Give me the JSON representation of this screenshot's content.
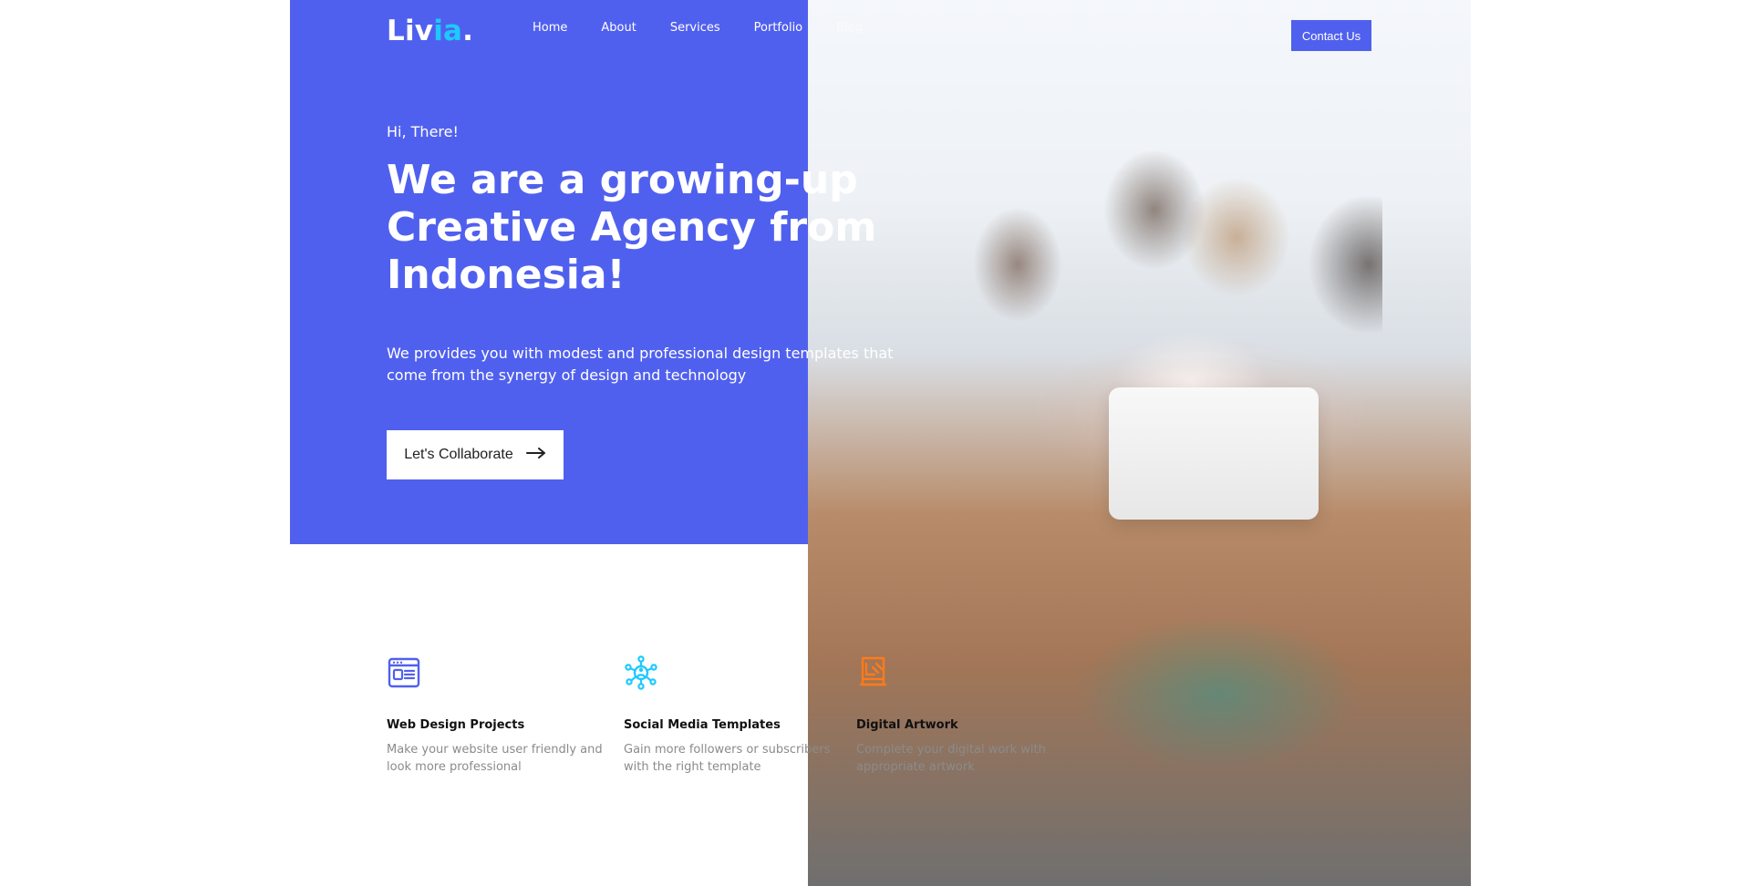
{
  "header": {
    "logo_prefix": "Liv",
    "logo_accent": "ia",
    "logo_suffix": ".",
    "nav": [
      "Home",
      "About",
      "Services",
      "Portfolio",
      "Blog"
    ],
    "contact_label": "Contact Us"
  },
  "hero": {
    "greeting": "Hi, There!",
    "headline": "We are a growing-up Creative Agency from Indonesia!",
    "lead": "We provides you with modest and professional design templates that come from the synergy of design and technology",
    "cta_label": "Let's Collaborate"
  },
  "services": [
    {
      "icon": "web-browser-icon",
      "title": "Web Design Projects",
      "description": "Make your website user friendly and look more professional"
    },
    {
      "icon": "network-share-icon",
      "title": "Social Media Templates",
      "description": "Gain more followers or subscribers with the right template"
    },
    {
      "icon": "artwork-board-icon",
      "title": "Digital Artwork",
      "description": "Complete your digital work with appropriate artwork"
    }
  ],
  "colors": {
    "primary": "#5060EE",
    "logo_accent": "#1EC9FF",
    "web_icon": "#5060EE",
    "social_icon": "#1EC9FF",
    "artwork_icon": "#FF7A1A",
    "muted_text": "#8B8B8B"
  }
}
